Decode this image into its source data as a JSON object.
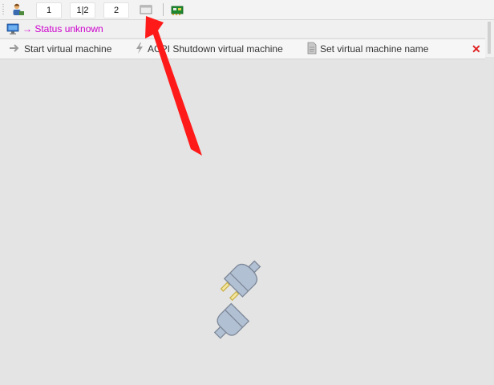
{
  "toolbar": {
    "buttons": [
      "1",
      "1|2",
      "2"
    ]
  },
  "status": {
    "text": "→ Status unknown",
    "color": "#cc00cc"
  },
  "actions": {
    "start": "Start virtual machine",
    "shutdown": "ACPI Shutdown virtual machine",
    "set_name": "Set virtual machine name",
    "close": "✕"
  },
  "icons": {
    "user": "user-icon",
    "monitor": "monitor-icon",
    "window": "window-icon",
    "network": "network-card-icon",
    "disconnected": "disconnected-plug-icon",
    "arrow": "red-pointer-arrow"
  },
  "colors": {
    "status_text": "#cc00cc",
    "close": "#e02020",
    "plug": "#b2c0d4",
    "arrow": "#ff1a1a"
  }
}
